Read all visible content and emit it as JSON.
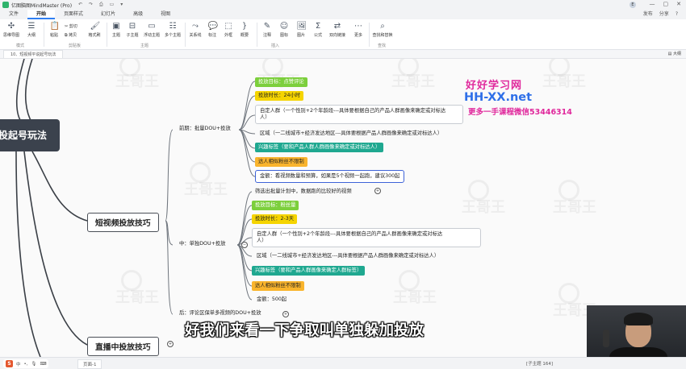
{
  "titlebar": {
    "app_name": "亿图脑图MindMaster (Pro)",
    "avatar_letter": "E"
  },
  "menu": {
    "tabs": [
      "文件",
      "开始",
      "页面样式",
      "幻灯片",
      "高级",
      "视图"
    ],
    "active": "开始",
    "right": [
      "发布",
      "分享",
      "?"
    ]
  },
  "ribbon": {
    "mode_buttons": [
      "思维导图",
      "大纲"
    ],
    "clipboard": {
      "paste": "粘贴",
      "cut": "剪切",
      "copy": "拷贝",
      "format": "格式刷"
    },
    "insert_topic": [
      "主题",
      "子主题",
      "浮动主题",
      "多个主题"
    ],
    "insert_items": [
      "关系线",
      "标注",
      "外框",
      "概要"
    ],
    "insert_misc": [
      "注释",
      "图标",
      "图片",
      "公式",
      "双向链接",
      "更多"
    ],
    "find": "查找和替换",
    "groups": [
      "模式",
      "剪贴板",
      "主题",
      "插入",
      "查找"
    ]
  },
  "doc": {
    "tab_title": "10、短视频平说起号玩法",
    "outline_label": "大纲"
  },
  "mindmap": {
    "root_text": "投起号玩法",
    "main1": "短视频投放技巧",
    "main2": "直播中投放技巧",
    "branch_pre": "前期：批量DOU+投放",
    "branch_mid": "中：单独DOU+投放",
    "branch_post": "后：评论区保单多视频的DOU+投放",
    "pre_items": [
      "投放目标：点赞评论",
      "投放时长：24小时",
      "自定人群（一个性别+2个年龄段---具体要根据自己的产品人群画像来确定或对标达",
      "人）",
      "区域（一二线城市+经济发达地区---具体要根据产品人群画像来确定或对标达人）",
      "兴趣标签（要和产品人群人群画像来确定或对标达人）",
      "达人相似粉丝不限制",
      "金额：看视频数量和预算，如果是5个视频一起跑，建议300起"
    ],
    "mid_items": [
      "筛选出批量计划中，数据跑的比较好的视频",
      "投放目标：粉丝量",
      "投放时长：2-3天",
      "自定人群（一个性别+2个年龄段---具体要根据自己的产品人群画像来确定或对标达",
      "人）",
      "区域（一二线城市+经济发达地区---具体要根据产品人群画像来确定或对标达人）",
      "兴趣标签（要和产品人群画像来确定人群标签）",
      "达人相似粉丝不限制",
      "金额：500起"
    ],
    "watermark": "王哥王"
  },
  "overlay": {
    "site_cn": "好好学习网",
    "site_url": "HH-XX.net",
    "contact": "更多一手课程微信53446314",
    "subtitle": "好我们来看一下争取叫单独躲加投放"
  },
  "status": {
    "page": "页面-1",
    "count": "[子主题 164]",
    "ime": "中"
  }
}
